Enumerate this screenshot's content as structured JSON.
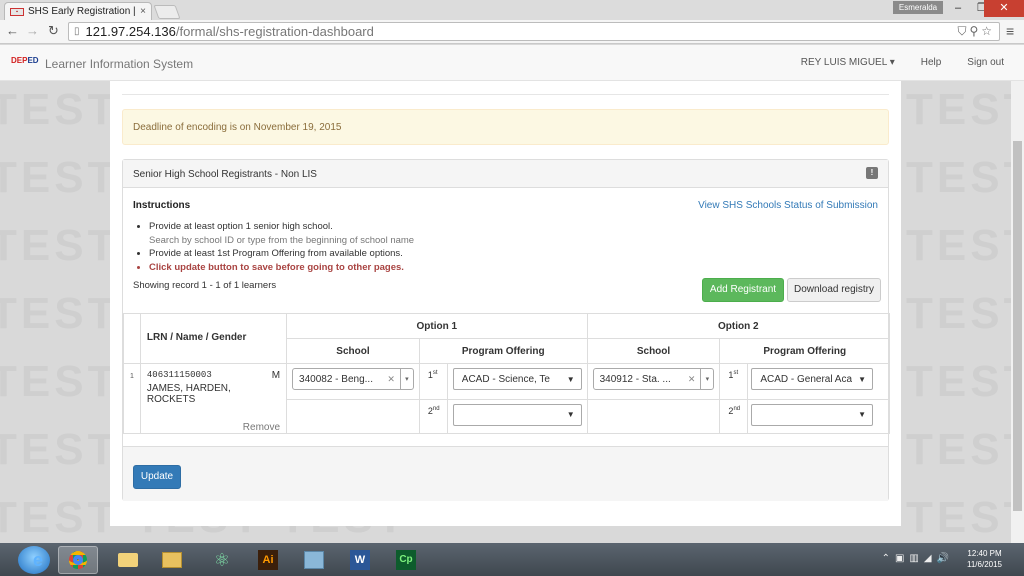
{
  "browser": {
    "tab_title": "SHS Early Registration | Le",
    "tab_close": "×",
    "profile_name": "Esmeralda",
    "url_host": "121.97.254.136",
    "url_path": "/formal/shs-registration-dashboard"
  },
  "app": {
    "logo_text_a": "DEP",
    "logo_text_b": "ED",
    "brand": "Learner Information System",
    "nav": {
      "user": "REY LUIS MIGUEL",
      "help": "Help",
      "signout": "Sign out"
    },
    "watermark_text": "TEST"
  },
  "alert": {
    "text": "Deadline of encoding is on November 19, 2015"
  },
  "panel": {
    "title": "Senior High School Registrants - Non LIS",
    "badge": "!",
    "instructions_title": "Instructions",
    "status_link": "View SHS Schools Status of Submission",
    "instructions": [
      "Provide at least option 1 senior high school.",
      "Search by school ID or type from the beginning of school name",
      "Provide at least 1st Program Offering from available options.",
      "Click update button to save before going to other pages."
    ],
    "showing": "Showing record 1 - 1 of 1 learners",
    "add_button": "Add Registrant",
    "download_button": "Download registry",
    "update_button": "Update"
  },
  "table": {
    "headers": {
      "learner": "LRN / Name / Gender",
      "option1": "Option 1",
      "option2": "Option 2",
      "school": "School",
      "program": "Program Offering"
    },
    "ordinals": {
      "first_num": "1",
      "first_suf": "st",
      "second_num": "2",
      "second_suf": "nd"
    },
    "rows": [
      {
        "index": "1",
        "lrn": "406311150003",
        "gender": "M",
        "name": "JAMES, HARDEN, ROCKETS",
        "remove": "Remove",
        "opt1_school": "340082 - Beng...",
        "opt1_prog1": "ACAD - Science, Te",
        "opt1_prog2": "",
        "opt2_school": "340912 - Sta. ...",
        "opt2_prog1": "ACAD - General Aca",
        "opt2_prog2": ""
      }
    ]
  },
  "taskbar": {
    "time": "12:40 PM",
    "date": "11/6/2015"
  }
}
